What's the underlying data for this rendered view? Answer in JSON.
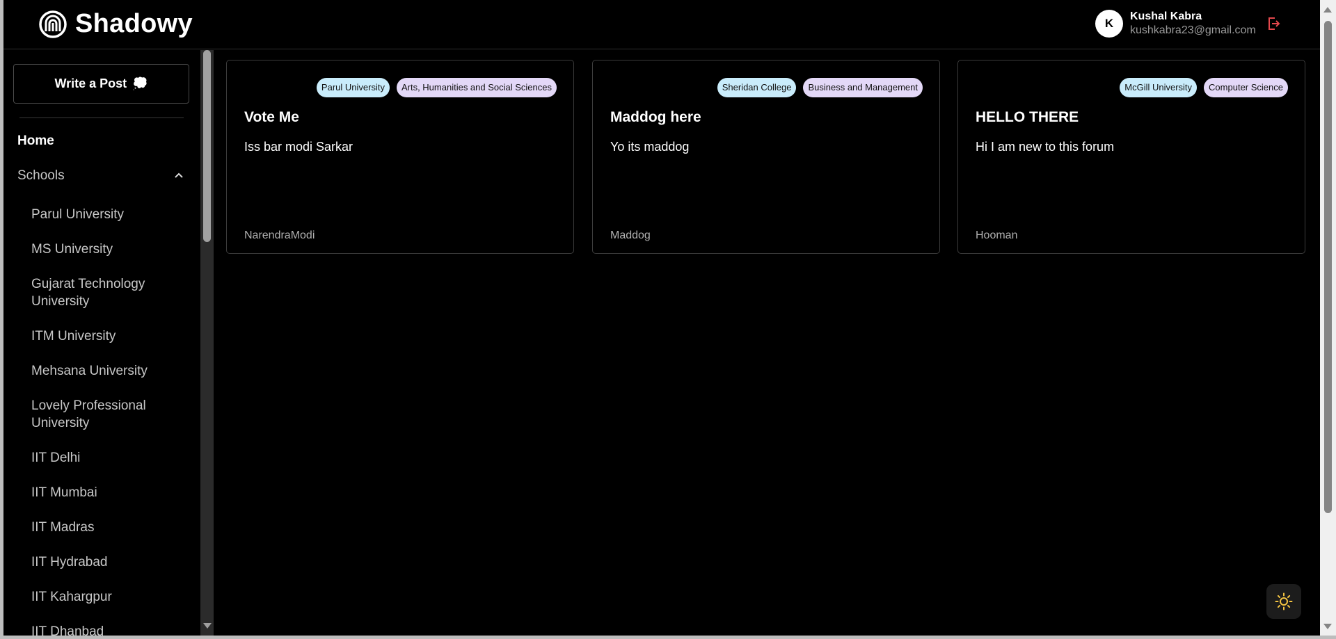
{
  "header": {
    "brand": "Shadowy",
    "user": {
      "initial": "K",
      "name": "Kushal Kabra",
      "email": "kushkabra23@gmail.com"
    }
  },
  "sidebar": {
    "write_post_label": "Write a Post",
    "write_post_icon": "💭",
    "home_label": "Home",
    "schools_label": "Schools",
    "schools": [
      "Parul University",
      "MS University",
      "Gujarat Technology University",
      "ITM University",
      "Mehsana University",
      "Lovely Professional University",
      "IIT Delhi",
      "IIT Mumbai",
      "IIT Madras",
      "IIT Hydrabad",
      "IIT Kahargpur",
      "IIT Dhanbad"
    ]
  },
  "posts": [
    {
      "school": "Parul University",
      "subject": "Arts, Humanities and Social Sciences",
      "title": "Vote Me",
      "body": "Iss bar modi Sarkar",
      "author": "NarendraModi"
    },
    {
      "school": "Sheridan College",
      "subject": "Business and Management",
      "title": "Maddog here",
      "body": "Yo its maddog",
      "author": "Maddog"
    },
    {
      "school": "McGill University",
      "subject": "Computer Science",
      "title": "HELLO THERE",
      "body": "Hi I am new to this forum",
      "author": "Hooman"
    }
  ],
  "colors": {
    "logout": "#e5484d",
    "theme_icon": "#f5c542",
    "tag_school": "#c9ecfb",
    "tag_subject": "#e3d8f7"
  },
  "icons": {
    "logo": "logo-icon",
    "logout": "logout-icon",
    "collapse": "chevron-up-icon",
    "theme": "sun-icon"
  }
}
